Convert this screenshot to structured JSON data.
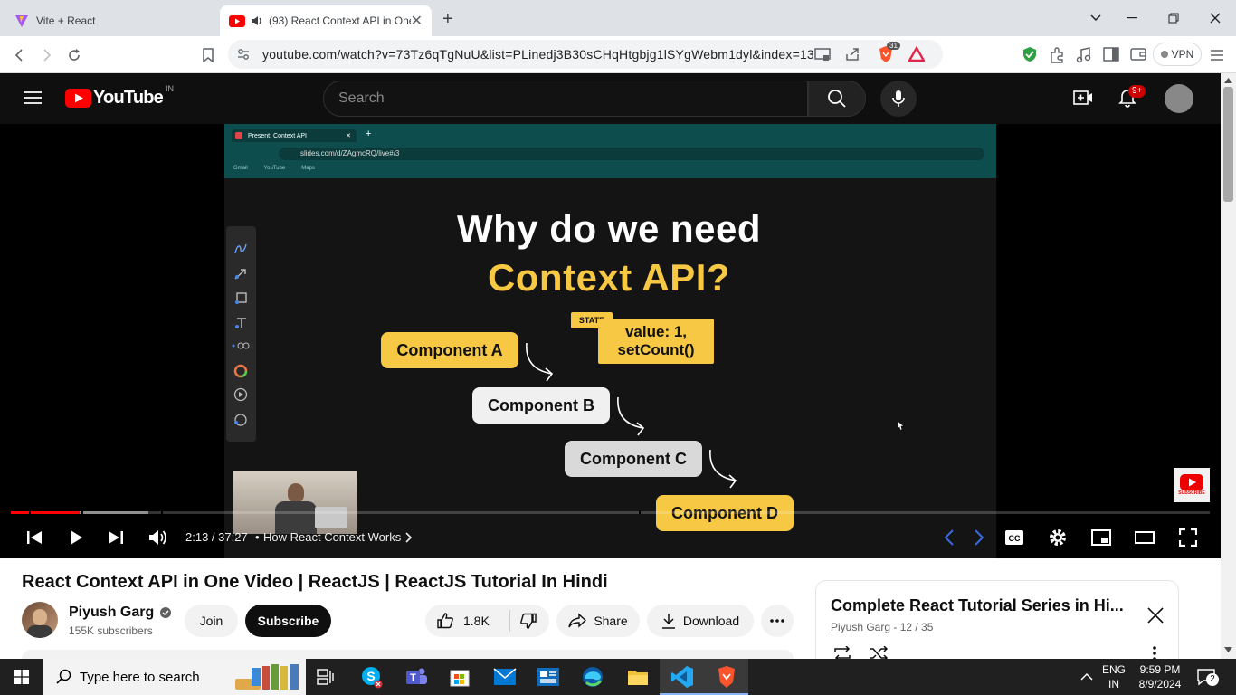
{
  "browser": {
    "tabs": [
      {
        "title": "Vite + React"
      },
      {
        "title": "(93) React Context API in One"
      }
    ],
    "url": "youtube.com/watch?v=73Tz6qTgNuU&list=PLinedj3B30sCHqHtgbjg1lSYgWebm1dyl&index=13",
    "vpn_label": "VPN",
    "brave_badge": "31"
  },
  "youtube": {
    "logo_text": "YouTube",
    "region": "IN",
    "search_placeholder": "Search",
    "notif_badge": "9+"
  },
  "video": {
    "slide": {
      "tab_title": "Present: Context API",
      "url": "slides.com/d/ZAgmcRQ/live#/3",
      "bookmarks": [
        "Gmail",
        "YouTube",
        "Maps"
      ],
      "heading_line1": "Why do we need",
      "heading_line2": "Context API?",
      "state_tag": "STATE",
      "state_value": "value: 1,",
      "state_setter": "setCount()",
      "components": [
        "Component A",
        "Component B",
        "Component C",
        "Component D"
      ]
    },
    "subscribe_watermark": "SUBSCRIBE",
    "time": "2:13 / 37:27",
    "chapter": "How React Context Works",
    "progress_fraction": 0.057
  },
  "info": {
    "title": "React Context API in One Video | ReactJS | ReactJS Tutorial In Hindi",
    "channel": "Piyush Garg",
    "subscribers": "155K subscribers",
    "join_label": "Join",
    "subscribe_label": "Subscribe",
    "likes": "1.8K",
    "share_label": "Share",
    "download_label": "Download"
  },
  "playlist": {
    "title": "Complete React Tutorial Series in Hi...",
    "meta": "Piyush Garg - 12 / 35"
  },
  "taskbar": {
    "search_placeholder": "Type here to search",
    "lang1": "ENG",
    "lang2": "IN",
    "time": "9:59 PM",
    "date": "8/9/2024",
    "notif_count": "2"
  },
  "colors": {
    "yt_red": "#ff0000",
    "slide_yellow": "#f7c843",
    "slide_teal": "#0e4d4d",
    "taskbar": "#202020"
  }
}
